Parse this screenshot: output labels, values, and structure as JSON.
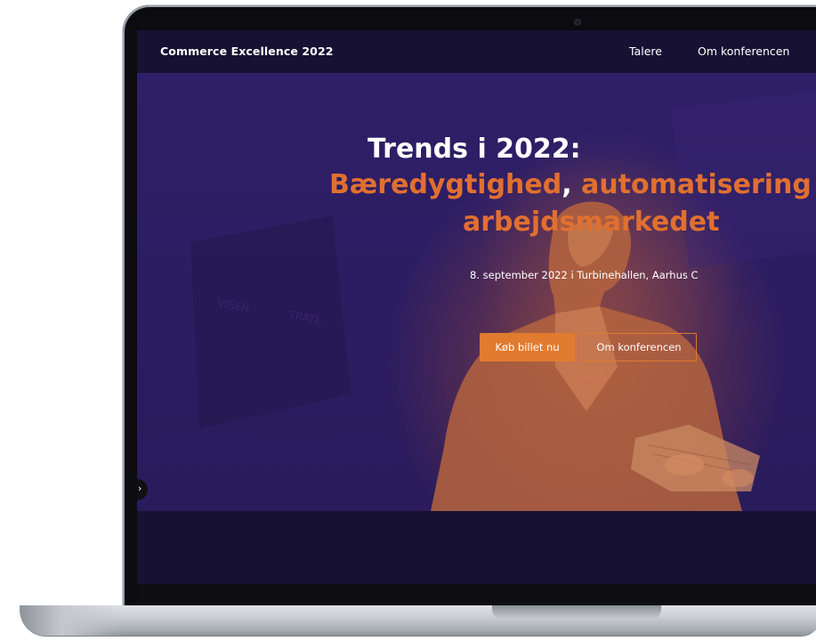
{
  "site": {
    "brand": "Commerce Excellence 2022"
  },
  "nav": {
    "items": [
      {
        "label": "Talere"
      },
      {
        "label": "Om konferencen"
      }
    ]
  },
  "hero": {
    "title_line1": "Trends i 2022:",
    "title_line2_part1": "Bæredygtighed",
    "title_line2_comma": ",",
    "title_line2_part2": " automatisering o",
    "title_line3": "arbejdsmarkedet",
    "subtitle": "8. september 2022 i Turbinehallen, Aarhus C",
    "primary_button": "Køb billet nu",
    "secondary_button": "Om konferencen",
    "slider_prev_glyph": "›"
  },
  "colors": {
    "accent": "#e17b2f",
    "headline_orange": "#e0702f",
    "hero_background": "#2e1f68",
    "nav_background": "#171233"
  },
  "icons": {
    "slider_arrow": "chevron-right-icon"
  }
}
